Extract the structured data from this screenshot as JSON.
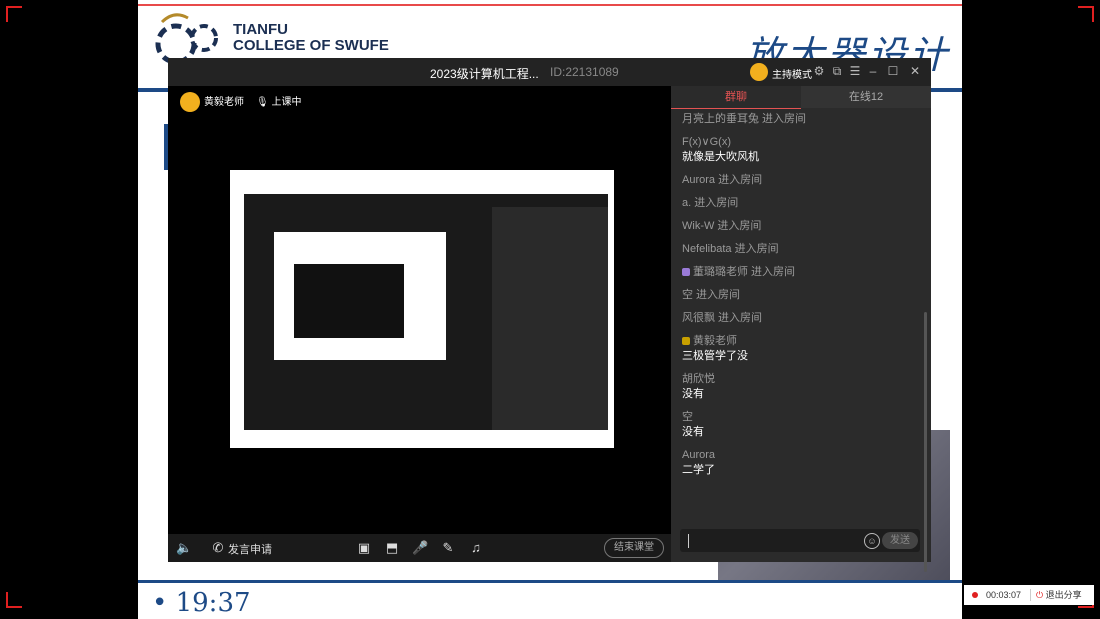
{
  "colors": {
    "accent": "#e45353",
    "brand_blue": "#1d4a86",
    "record": "#e02020"
  },
  "slide": {
    "college_en_1": "TIANFU",
    "college_en_2": "COLLEGE OF SWUFE",
    "title": "放大器设计",
    "bullet_time": "• 19:37"
  },
  "window": {
    "title": "2023级计算机工程...",
    "id": "ID:22131089",
    "host_mode": "主持模式",
    "controls": [
      "settings-icon",
      "popout-icon",
      "menu-icon",
      "minimize-icon",
      "maximize-icon",
      "close-icon"
    ]
  },
  "video": {
    "teacher_name": "黄毅老师",
    "status": "上课中"
  },
  "bottombar": {
    "speak_request": "发言申请",
    "end_class": "结束课堂",
    "icons": [
      "speaker-icon",
      "phone-icon",
      "camera-off-icon",
      "screen-share-icon",
      "microphone-icon",
      "edit-icon",
      "music-icon"
    ]
  },
  "chat": {
    "tab_group": "群聊",
    "tab_online": "在线12",
    "messages": [
      {
        "type": "sys",
        "text": "月亮上的垂耳兔 进入房间"
      },
      {
        "type": "msg",
        "who": "F(x)∨G(x)",
        "text": "就像是大吹风机"
      },
      {
        "type": "sys",
        "text": "Aurora 进入房间"
      },
      {
        "type": "sys",
        "text": "a. 进入房间"
      },
      {
        "type": "sys",
        "text": "Wik-W 进入房间"
      },
      {
        "type": "sys",
        "text": "Nefelibata 进入房间"
      },
      {
        "type": "sys_badge",
        "text": "董璐璐老师 进入房间"
      },
      {
        "type": "sys",
        "text": "空 进入房间"
      },
      {
        "type": "sys",
        "text": "风很飘 进入房间"
      },
      {
        "type": "msg_badge",
        "who": "黄毅老师",
        "text": "三极管学了没"
      },
      {
        "type": "msg",
        "who": "胡欣悦",
        "text": "没有"
      },
      {
        "type": "msg",
        "who": "空",
        "text": "没有"
      },
      {
        "type": "msg",
        "who": "Aurora",
        "text": "二学了"
      }
    ],
    "send_label": "发送"
  },
  "recording": {
    "time": "00:03:07",
    "exit_label": "退出分享"
  }
}
